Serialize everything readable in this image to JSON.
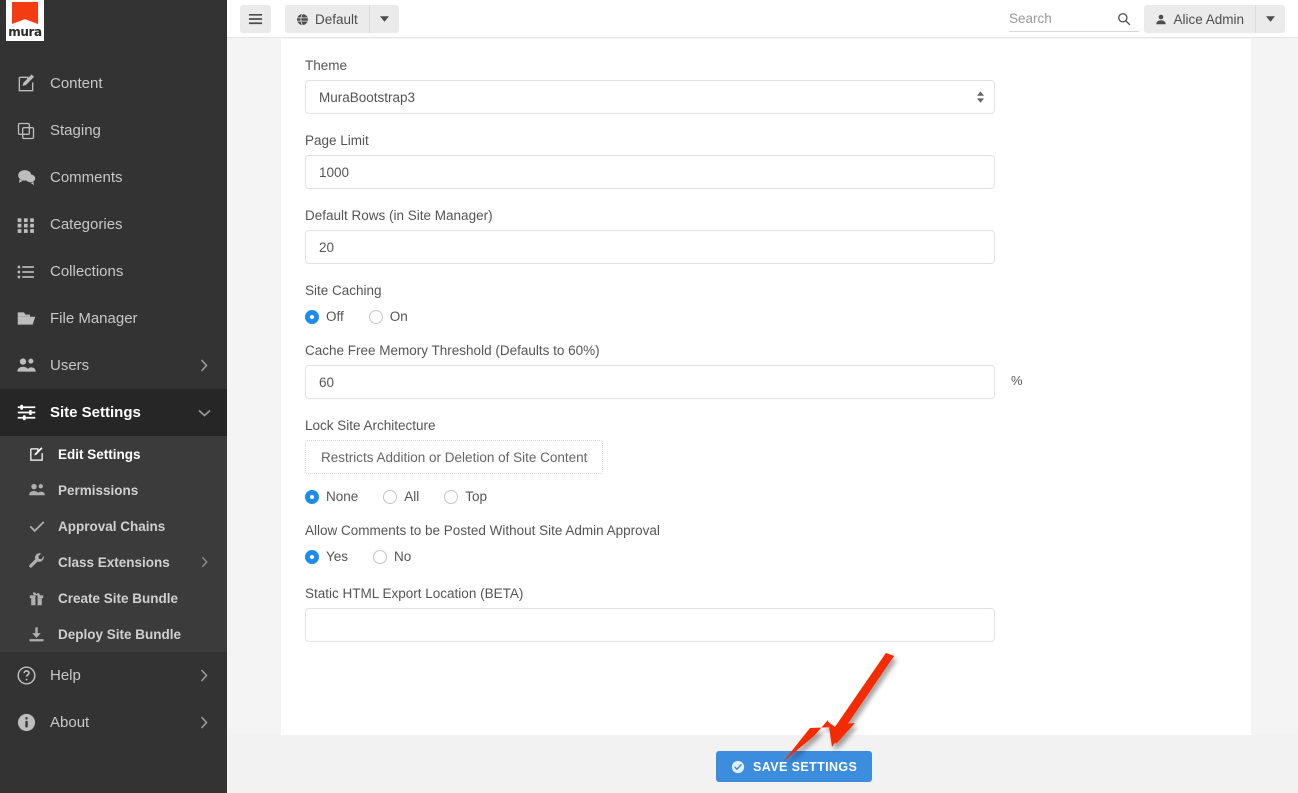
{
  "brand": {
    "logo_text": "mura"
  },
  "sidebar": {
    "items": [
      {
        "label": "Content",
        "icon": "pencil-square-icon",
        "chevron": false,
        "active": false
      },
      {
        "label": "Staging",
        "icon": "copy-icon",
        "chevron": false,
        "active": false
      },
      {
        "label": "Comments",
        "icon": "comment-icon",
        "chevron": false,
        "active": false
      },
      {
        "label": "Categories",
        "icon": "grid-icon",
        "chevron": false,
        "active": false
      },
      {
        "label": "Collections",
        "icon": "list-icon",
        "chevron": false,
        "active": false
      },
      {
        "label": "File Manager",
        "icon": "folder-icon",
        "chevron": false,
        "active": false
      },
      {
        "label": "Users",
        "icon": "users-icon",
        "chevron": true,
        "active": false
      },
      {
        "label": "Site Settings",
        "icon": "sliders-icon",
        "chevron": true,
        "active": true
      }
    ],
    "submenu": [
      {
        "label": "Edit Settings",
        "icon": "pencil-square-icon",
        "chevron": false,
        "active": true
      },
      {
        "label": "Permissions",
        "icon": "users-icon",
        "chevron": false,
        "active": false
      },
      {
        "label": "Approval Chains",
        "icon": "check-icon",
        "chevron": false,
        "active": false
      },
      {
        "label": "Class Extensions",
        "icon": "wrench-icon",
        "chevron": true,
        "active": false
      },
      {
        "label": "Create Site Bundle",
        "icon": "gift-icon",
        "chevron": false,
        "active": false
      },
      {
        "label": "Deploy Site Bundle",
        "icon": "download-icon",
        "chevron": false,
        "active": false
      }
    ],
    "bottom_items": [
      {
        "label": "Help",
        "icon": "question-circle-icon",
        "chevron": true
      },
      {
        "label": "About",
        "icon": "info-circle-icon",
        "chevron": true
      }
    ]
  },
  "header": {
    "menu_toggle_icon": "hamburger-icon",
    "site_selector": {
      "label": "Default",
      "icon": "globe-icon",
      "caret_icon": "caret-down-icon"
    },
    "search": {
      "placeholder": "Search",
      "value": "",
      "icon": "search-icon"
    },
    "user": {
      "label": "Alice Admin",
      "icon": "user-icon",
      "caret_icon": "caret-down-icon"
    }
  },
  "form": {
    "theme": {
      "label": "Theme",
      "value": "MuraBootstrap3",
      "options": [
        "MuraBootstrap3"
      ]
    },
    "page_limit": {
      "label": "Page Limit",
      "value": "1000"
    },
    "default_rows": {
      "label": "Default Rows (in Site Manager)",
      "value": "20"
    },
    "site_caching": {
      "label": "Site Caching",
      "options": [
        {
          "label": "Off",
          "selected": true
        },
        {
          "label": "On",
          "selected": false
        }
      ]
    },
    "cache_threshold": {
      "label": "Cache Free Memory Threshold (Defaults to 60%)",
      "value": "60",
      "suffix": "%"
    },
    "lock_site_architecture": {
      "label": "Lock Site Architecture",
      "hint": "Restricts Addition or Deletion of Site Content",
      "options": [
        {
          "label": "None",
          "selected": true
        },
        {
          "label": "All",
          "selected": false
        },
        {
          "label": "Top",
          "selected": false
        }
      ]
    },
    "allow_comments": {
      "label": "Allow Comments to be Posted Without Site Admin Approval",
      "options": [
        {
          "label": "Yes",
          "selected": true
        },
        {
          "label": "No",
          "selected": false
        }
      ]
    },
    "static_export": {
      "label": "Static HTML Export Location (BETA)",
      "value": "",
      "placeholder": ""
    }
  },
  "footer": {
    "save_label": "SAVE SETTINGS",
    "save_icon": "check-circle-icon"
  },
  "annotation": {
    "arrow_icon": "red-arrow-icon",
    "color": "#f42a00"
  },
  "colors": {
    "sidebar_bg": "#333333",
    "sidebar_active_bg": "#262626",
    "submenu_bg": "#3b3b3b",
    "accent_blue": "#3c8dde",
    "radio_blue": "#1f8ceb",
    "brand_orange": "#f43c13",
    "page_bg": "#f4f4f4"
  }
}
